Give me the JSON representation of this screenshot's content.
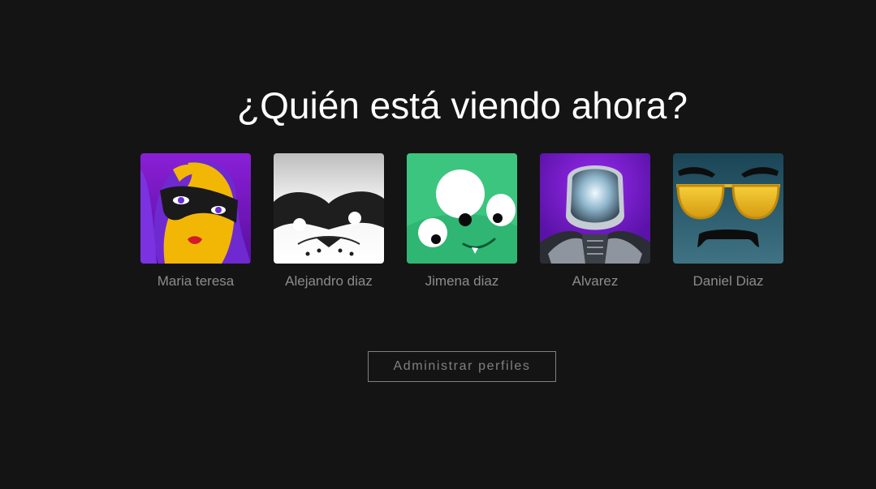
{
  "title": "¿Quién está viendo ahora?",
  "profiles": [
    {
      "name": "Maria teresa",
      "icon": "masked-woman-avatar-icon"
    },
    {
      "name": "Alejandro diaz",
      "icon": "masked-dog-avatar-icon"
    },
    {
      "name": "Jimena diaz",
      "icon": "green-monster-avatar-icon"
    },
    {
      "name": "Alvarez",
      "icon": "robot-avatar-icon"
    },
    {
      "name": "Daniel Diaz",
      "icon": "sunglasses-face-avatar-icon"
    }
  ],
  "manage_label": "Administrar perfiles",
  "colors": {
    "background": "#141414",
    "title": "#ffffff",
    "muted": "#8c8c8c"
  }
}
